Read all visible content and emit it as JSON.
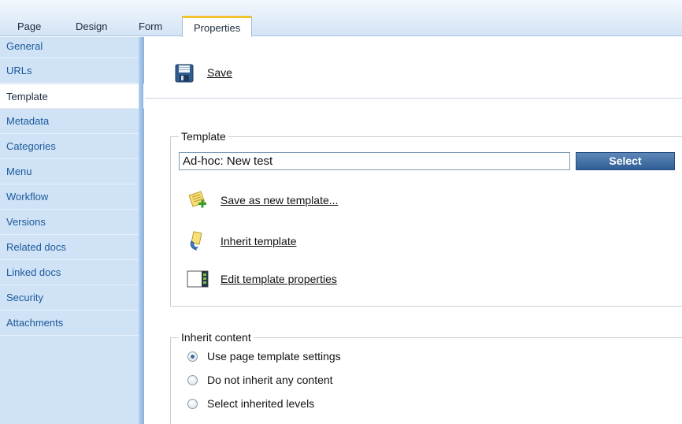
{
  "tabs": [
    {
      "label": "Page",
      "active": false
    },
    {
      "label": "Design",
      "active": false
    },
    {
      "label": "Form",
      "active": false
    },
    {
      "label": "Properties",
      "active": true
    }
  ],
  "sidebar": {
    "items": [
      {
        "label": "General"
      },
      {
        "label": "URLs"
      },
      {
        "label": "Template",
        "selected": true
      },
      {
        "label": "Metadata"
      },
      {
        "label": "Categories"
      },
      {
        "label": "Menu"
      },
      {
        "label": "Workflow"
      },
      {
        "label": "Versions"
      },
      {
        "label": "Related docs"
      },
      {
        "label": "Linked docs"
      },
      {
        "label": "Security"
      },
      {
        "label": "Attachments"
      }
    ]
  },
  "toolbar": {
    "save_label": "Save",
    "save_icon": "floppy-disk-icon"
  },
  "template_section": {
    "legend": "Template",
    "current_value": "Ad-hoc: New test",
    "select_label": "Select",
    "actions": [
      {
        "label": "Save as new template...",
        "icon": "save-template-icon"
      },
      {
        "label": "Inherit template",
        "icon": "inherit-template-icon"
      },
      {
        "label": "Edit template properties",
        "icon": "edit-properties-icon"
      }
    ]
  },
  "inherit_section": {
    "legend": "Inherit content",
    "options": [
      {
        "label": "Use page template settings",
        "checked": true
      },
      {
        "label": "Do not inherit any content",
        "checked": false
      },
      {
        "label": "Select inherited levels",
        "checked": false
      }
    ]
  },
  "colors": {
    "accent_tab": "#f4c22f",
    "sidebar_bg": "#cfe2f6",
    "link_blue": "#1b5a9a",
    "select_button": "#2f5e96"
  }
}
